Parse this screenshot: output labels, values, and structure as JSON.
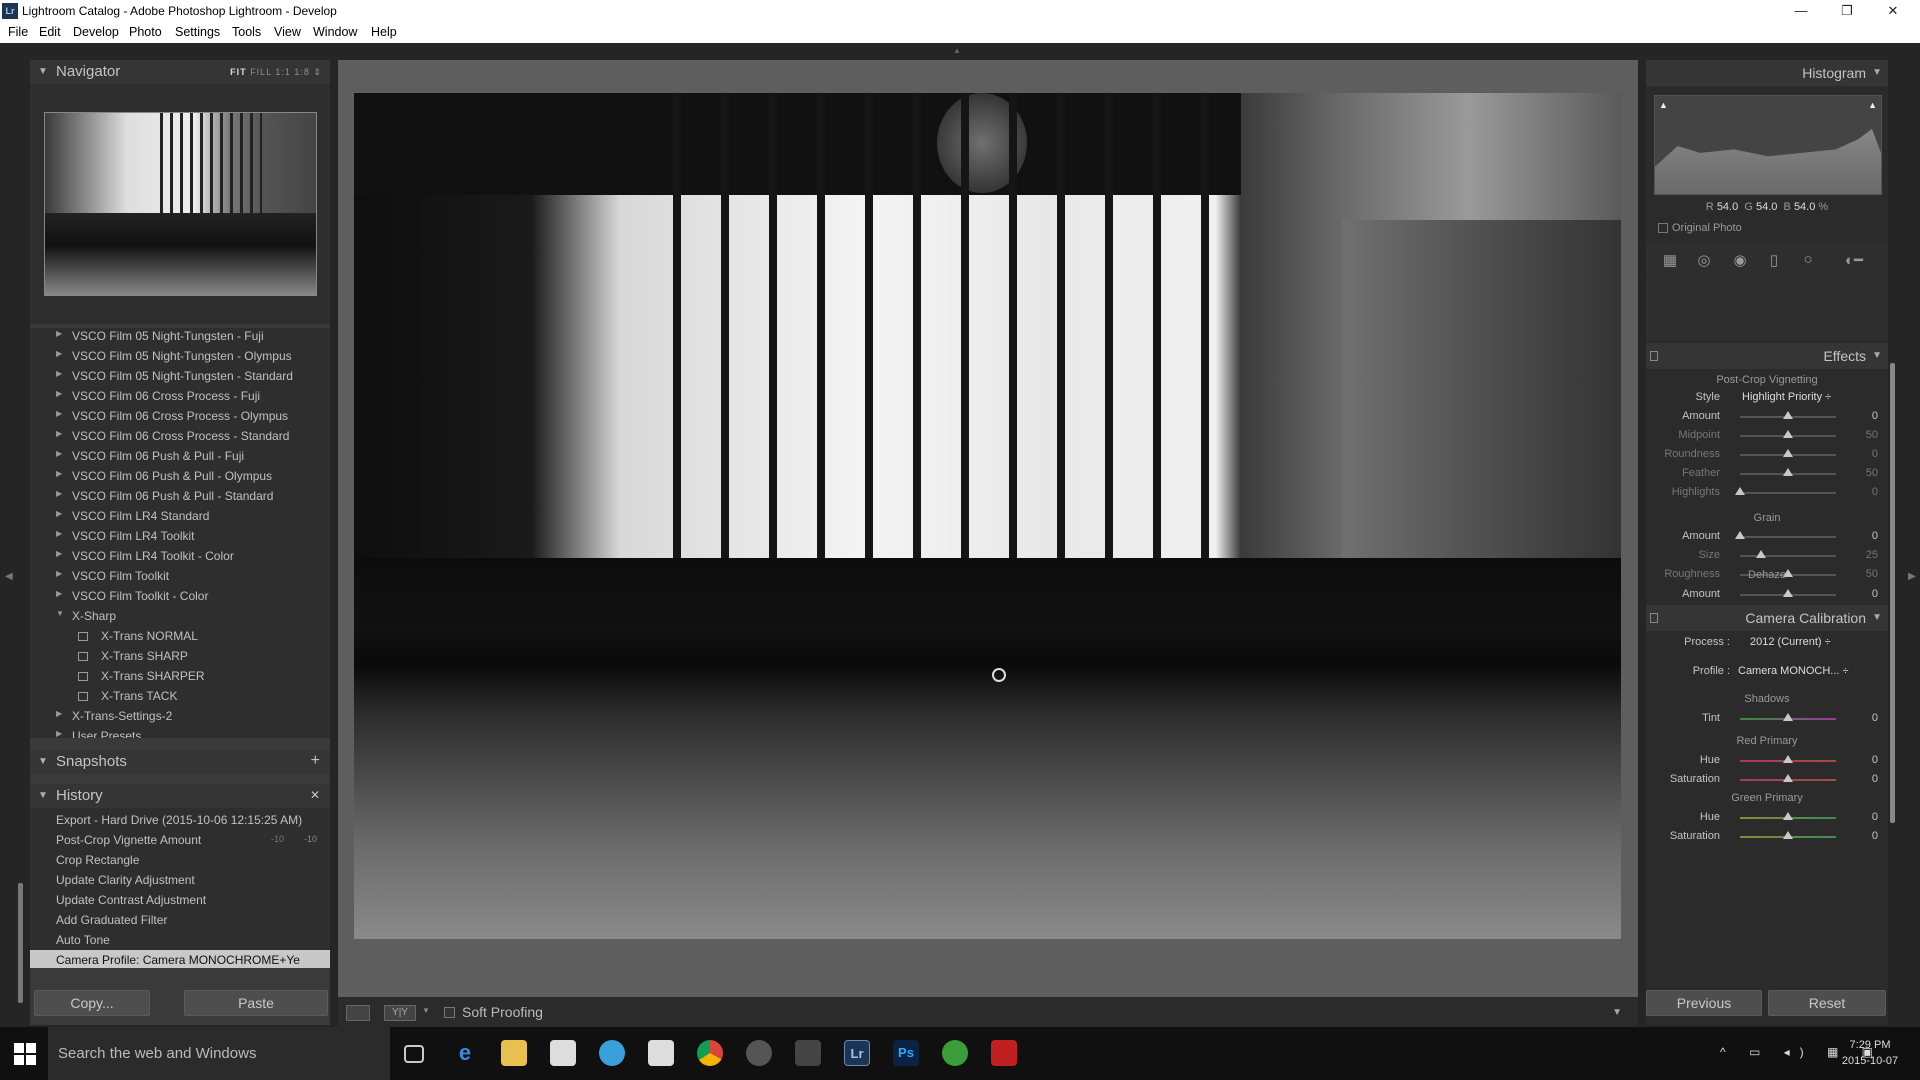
{
  "window": {
    "title": "Lightroom Catalog - Adobe Photoshop Lightroom - Develop",
    "app_icon": "Lr",
    "min": "—",
    "max": "❐",
    "close": "✕"
  },
  "menu": [
    "File",
    "Edit",
    "Develop",
    "Photo",
    "Settings",
    "Tools",
    "View",
    "Window",
    "Help"
  ],
  "navigator": {
    "title": "Navigator",
    "zoom": [
      "FIT",
      "FILL",
      "1:1",
      "1:8"
    ]
  },
  "presets": [
    {
      "label": "VSCO Film 05 Night-Tungsten - Fuji",
      "type": "folder"
    },
    {
      "label": "VSCO Film 05 Night-Tungsten - Olympus",
      "type": "folder"
    },
    {
      "label": "VSCO Film 05 Night-Tungsten - Standard",
      "type": "folder"
    },
    {
      "label": "VSCO Film 06 Cross Process - Fuji",
      "type": "folder"
    },
    {
      "label": "VSCO Film 06 Cross Process - Olympus",
      "type": "folder"
    },
    {
      "label": "VSCO Film 06 Cross Process - Standard",
      "type": "folder"
    },
    {
      "label": "VSCO Film 06 Push & Pull - Fuji",
      "type": "folder"
    },
    {
      "label": "VSCO Film 06 Push & Pull - Olympus",
      "type": "folder"
    },
    {
      "label": "VSCO Film 06 Push & Pull - Standard",
      "type": "folder"
    },
    {
      "label": "VSCO Film LR4 Standard",
      "type": "folder"
    },
    {
      "label": "VSCO Film LR4 Toolkit",
      "type": "folder"
    },
    {
      "label": "VSCO Film LR4 Toolkit - Color",
      "type": "folder"
    },
    {
      "label": "VSCO Film Toolkit",
      "type": "folder"
    },
    {
      "label": "VSCO Film Toolkit - Color",
      "type": "folder"
    },
    {
      "label": "X-Sharp",
      "type": "open"
    },
    {
      "label": "X-Trans NORMAL",
      "type": "preset"
    },
    {
      "label": "X-Trans SHARP",
      "type": "preset"
    },
    {
      "label": "X-Trans SHARPER",
      "type": "preset"
    },
    {
      "label": "X-Trans TACK",
      "type": "preset"
    },
    {
      "label": "X-Trans-Settings-2",
      "type": "folder"
    },
    {
      "label": "User Presets",
      "type": "folder"
    }
  ],
  "snapshots": {
    "title": "Snapshots",
    "add": "+"
  },
  "history": {
    "title": "History",
    "clear": "✕",
    "items": [
      {
        "label": "Export - Hard Drive (2015-10-06 12:15:25 AM)",
        "v1": "",
        "v2": "",
        "selected": false
      },
      {
        "label": "Post-Crop Vignette Amount",
        "v1": "-10",
        "v2": "-10",
        "selected": false
      },
      {
        "label": "Crop Rectangle",
        "v1": "",
        "v2": "",
        "selected": false
      },
      {
        "label": "Update Clarity Adjustment",
        "v1": "",
        "v2": "",
        "selected": false
      },
      {
        "label": "Update Contrast Adjustment",
        "v1": "",
        "v2": "",
        "selected": false
      },
      {
        "label": "Add Graduated Filter",
        "v1": "",
        "v2": "",
        "selected": false
      },
      {
        "label": "Auto Tone",
        "v1": "",
        "v2": "",
        "selected": false
      },
      {
        "label": "Camera Profile: Camera MONOCHROME+Ye FILT...",
        "v1": "",
        "v2": "",
        "selected": true
      }
    ]
  },
  "left_buttons": {
    "copy": "Copy...",
    "paste": "Paste"
  },
  "toolbar": {
    "soft_proofing": "Soft Proofing",
    "view_yy": "Y|Y"
  },
  "histogram": {
    "title": "Histogram",
    "r_label": "R",
    "r": "54.0",
    "g_label": "G",
    "g": "54.0",
    "b_label": "B",
    "b": "54.0",
    "pct": "%",
    "original_photo": "Original Photo"
  },
  "effects": {
    "title": "Effects",
    "vignette_title": "Post-Crop Vignetting",
    "style_label": "Style",
    "style_value": "Highlight Priority ÷",
    "vignette": [
      {
        "label": "Amount",
        "value": "0",
        "pos": 0.5,
        "dim": false
      },
      {
        "label": "Midpoint",
        "value": "50",
        "pos": 0.5,
        "dim": true
      },
      {
        "label": "Roundness",
        "value": "0",
        "pos": 0.5,
        "dim": true
      },
      {
        "label": "Feather",
        "value": "50",
        "pos": 0.5,
        "dim": true
      },
      {
        "label": "Highlights",
        "value": "0",
        "pos": 0.0,
        "dim": true
      }
    ],
    "grain_title": "Grain",
    "grain": [
      {
        "label": "Amount",
        "value": "0",
        "pos": 0.0,
        "dim": false
      },
      {
        "label": "Size",
        "value": "25",
        "pos": 0.22,
        "dim": true
      },
      {
        "label": "Roughness",
        "value": "50",
        "pos": 0.5,
        "dim": true
      }
    ],
    "dehaze_title": "Dehaze",
    "dehaze": [
      {
        "label": "Amount",
        "value": "0",
        "pos": 0.5,
        "dim": false
      }
    ]
  },
  "calibration": {
    "title": "Camera Calibration",
    "process_label": "Process :",
    "process_value": "2012 (Current) ÷",
    "profile_label": "Profile :",
    "profile_value": "Camera MONOCH... ÷",
    "shadows_title": "Shadows",
    "shadows": [
      {
        "label": "Tint",
        "value": "0",
        "pos": 0.5,
        "dim": false
      }
    ],
    "red_title": "Red Primary",
    "red": [
      {
        "label": "Hue",
        "value": "0",
        "pos": 0.5,
        "dim": false
      },
      {
        "label": "Saturation",
        "value": "0",
        "pos": 0.5,
        "dim": false
      }
    ],
    "green_title": "Green Primary",
    "green": [
      {
        "label": "Hue",
        "value": "0",
        "pos": 0.5,
        "dim": false
      },
      {
        "label": "Saturation",
        "value": "0",
        "pos": 0.5,
        "dim": false
      }
    ]
  },
  "right_buttons": {
    "previous": "Previous",
    "reset": "Reset"
  },
  "taskbar": {
    "search_placeholder": "Search the web and Windows",
    "time": "7:29 PM",
    "date": "2015-10-07",
    "apps": [
      "task-view",
      "edge",
      "file-explorer",
      "store",
      "cortana-app",
      "calculator",
      "chrome",
      "steam",
      "app-spy",
      "lightroom",
      "photoshop",
      "app-green",
      "app-red"
    ],
    "app_labels": {
      "lightroom": "Lr",
      "photoshop": "Ps"
    }
  }
}
